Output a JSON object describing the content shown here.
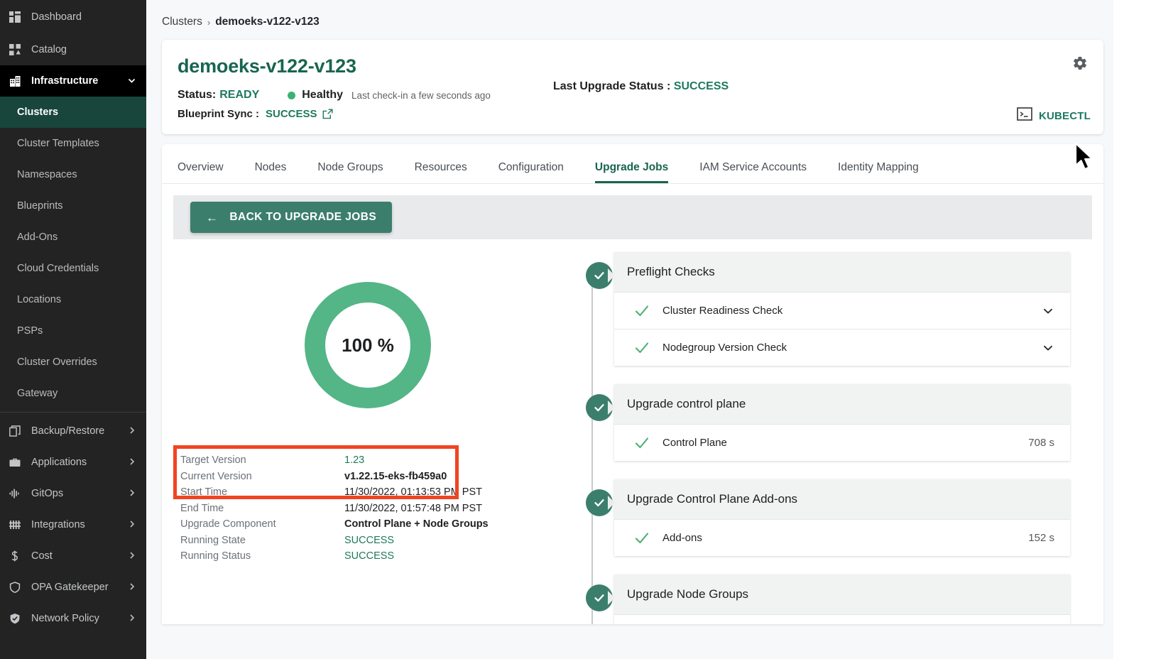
{
  "sidebar": {
    "items": [
      {
        "label": "Dashboard",
        "icon": "dashboard-icon",
        "type": "top"
      },
      {
        "label": "Catalog",
        "icon": "catalog-icon",
        "type": "top"
      },
      {
        "label": "Infrastructure",
        "icon": "infrastructure-icon",
        "type": "expanded",
        "chevron": "chevron-down-icon"
      }
    ],
    "sub_items": [
      {
        "label": "Clusters",
        "active": true
      },
      {
        "label": "Cluster Templates",
        "active": false
      },
      {
        "label": "Namespaces",
        "active": false
      },
      {
        "label": "Blueprints",
        "active": false
      },
      {
        "label": "Add-Ons",
        "active": false
      },
      {
        "label": "Cloud Credentials",
        "active": false
      },
      {
        "label": "Locations",
        "active": false
      },
      {
        "label": "PSPs",
        "active": false
      },
      {
        "label": "Cluster Overrides",
        "active": false
      },
      {
        "label": "Gateway",
        "active": false
      }
    ],
    "bottom_items": [
      {
        "label": "Backup/Restore",
        "icon": "copy-icon",
        "chevron": "chevron-right-icon"
      },
      {
        "label": "Applications",
        "icon": "briefcase-icon",
        "chevron": "chevron-right-icon"
      },
      {
        "label": "GitOps",
        "icon": "waveform-icon",
        "chevron": "chevron-right-icon"
      },
      {
        "label": "Integrations",
        "icon": "grid-lines-icon",
        "chevron": "chevron-right-icon"
      },
      {
        "label": "Cost",
        "icon": "dollar-icon",
        "chevron": "chevron-right-icon"
      },
      {
        "label": "OPA Gatekeeper",
        "icon": "shield-icon",
        "chevron": "chevron-right-icon"
      },
      {
        "label": "Network Policy",
        "icon": "shield-check-icon",
        "chevron": "chevron-right-icon"
      }
    ]
  },
  "breadcrumb": {
    "root": "Clusters",
    "separator": "›",
    "current": "demoeks-v122-v123"
  },
  "header": {
    "title": "demoeks-v122-v123",
    "status_label": "Status:",
    "status_value": "READY",
    "health": "Healthy",
    "checkin": "Last check-in a few seconds ago",
    "upgrade_status_label": "Last Upgrade Status :",
    "upgrade_status_value": "SUCCESS",
    "blueprint_label": "Blueprint Sync :",
    "blueprint_value": "SUCCESS",
    "kubectl_label": "KUBECTL",
    "gear_icon": "gear-icon",
    "external_link_icon": "external-link-icon",
    "terminal_icon": "terminal-icon"
  },
  "tabs": [
    {
      "label": "Overview",
      "active": false
    },
    {
      "label": "Nodes",
      "active": false
    },
    {
      "label": "Node Groups",
      "active": false
    },
    {
      "label": "Resources",
      "active": false
    },
    {
      "label": "Configuration",
      "active": false
    },
    {
      "label": "Upgrade Jobs",
      "active": true
    },
    {
      "label": "IAM Service Accounts",
      "active": false
    },
    {
      "label": "Identity Mapping",
      "active": false
    }
  ],
  "toolbar": {
    "back_label": "BACK TO UPGRADE JOBS",
    "back_arrow_icon": "arrow-left-icon"
  },
  "progress": {
    "percent_text": "100 %",
    "percent_value": 100,
    "ring_color": "#54b586"
  },
  "details": [
    {
      "label": "Target Version",
      "value": "1.23",
      "style": "green"
    },
    {
      "label": "Current Version",
      "value": "v1.22.15-eks-fb459a0",
      "style": "bold"
    },
    {
      "label": "Start Time",
      "value": "11/30/2022, 01:13:53 PM PST",
      "style": "plain"
    },
    {
      "label": "End Time",
      "value": "11/30/2022, 01:57:48 PM PST",
      "style": "plain"
    },
    {
      "label": "Upgrade Component",
      "value": "Control Plane + Node Groups",
      "style": "bold"
    },
    {
      "label": "Running State",
      "value": "SUCCESS",
      "style": "green"
    },
    {
      "label": "Running Status",
      "value": "SUCCESS",
      "style": "green"
    }
  ],
  "highlight": {
    "color": "#f04423"
  },
  "timeline": [
    {
      "title": "Preflight Checks",
      "status_icon": "check-circle-icon",
      "rows": [
        {
          "name": "Cluster Readiness Check",
          "duration": "",
          "caret": "chevron-down-icon"
        },
        {
          "name": "Nodegroup Version Check",
          "duration": "",
          "caret": "chevron-down-icon"
        }
      ]
    },
    {
      "title": "Upgrade control plane",
      "status_icon": "check-circle-icon",
      "rows": [
        {
          "name": "Control Plane",
          "duration": "708 s",
          "caret": ""
        }
      ]
    },
    {
      "title": "Upgrade Control Plane Add-ons",
      "status_icon": "check-circle-icon",
      "rows": [
        {
          "name": "Add-ons",
          "duration": "152 s",
          "caret": ""
        }
      ]
    },
    {
      "title": "Upgrade Node Groups",
      "status_icon": "check-circle-icon",
      "rows": []
    }
  ]
}
